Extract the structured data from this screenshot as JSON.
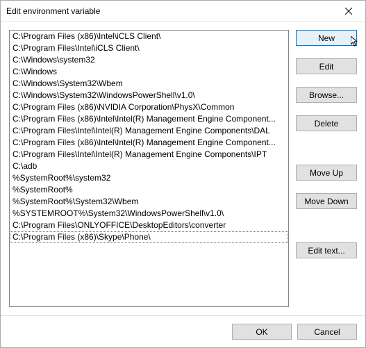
{
  "window": {
    "title": "Edit environment variable"
  },
  "list": {
    "items": [
      "C:\\Program Files (x86)\\Intel\\iCLS Client\\",
      "C:\\Program Files\\Intel\\iCLS Client\\",
      "C:\\Windows\\system32",
      "C:\\Windows",
      "C:\\Windows\\System32\\Wbem",
      "C:\\Windows\\System32\\WindowsPowerShell\\v1.0\\",
      "C:\\Program Files (x86)\\NVIDIA Corporation\\PhysX\\Common",
      "C:\\Program Files (x86)\\Intel\\Intel(R) Management Engine Component...",
      "C:\\Program Files\\Intel\\Intel(R) Management Engine Components\\DAL",
      "C:\\Program Files (x86)\\Intel\\Intel(R) Management Engine Component...",
      "C:\\Program Files\\Intel\\Intel(R) Management Engine Components\\IPT",
      "C:\\adb",
      "%SystemRoot%\\system32",
      "%SystemRoot%",
      "%SystemRoot%\\System32\\Wbem",
      "%SYSTEMROOT%\\System32\\WindowsPowerShell\\v1.0\\",
      "C:\\Program Files\\ONLYOFFICE\\DesktopEditors\\converter",
      "C:\\Program Files (x86)\\Skype\\Phone\\"
    ],
    "selected_index": 17
  },
  "buttons": {
    "new": "New",
    "edit": "Edit",
    "browse": "Browse...",
    "delete": "Delete",
    "move_up": "Move Up",
    "move_down": "Move Down",
    "edit_text": "Edit text...",
    "ok": "OK",
    "cancel": "Cancel"
  }
}
